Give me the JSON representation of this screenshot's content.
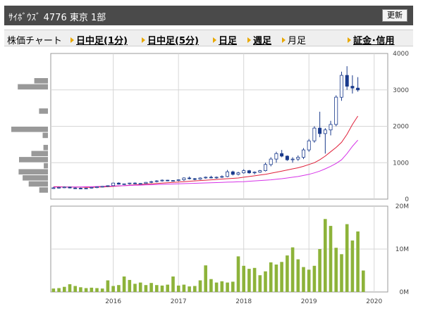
{
  "header": {
    "title": "ｻｲﾎﾞｳｽﾞ 4776 東京 1部",
    "refresh_label": "更新"
  },
  "nav": {
    "label": "株価チャート",
    "items": [
      {
        "label": "日中足(1分)",
        "link": true
      },
      {
        "label": "日中足(5分)",
        "link": true
      },
      {
        "label": "日足",
        "link": true
      },
      {
        "label": "週足",
        "link": true
      },
      {
        "label": "月足",
        "link": false
      },
      {
        "label": "証金･信用",
        "link": true
      }
    ]
  },
  "colors": {
    "up": "#ffffff",
    "down": "#1a3a8c",
    "ma_short": "#e0203a",
    "ma_long": "#d633e8",
    "volume": "#8db33a",
    "profile": "#999999"
  },
  "chart_data": [
    {
      "type": "candlestick",
      "title": "",
      "ylim": [
        0,
        4000
      ],
      "y_ticks": [
        "0",
        "1000",
        "2000",
        "3000",
        "4000"
      ],
      "x_ticks": [
        "2016",
        "2017",
        "2018",
        "2019",
        "2020"
      ],
      "x_start": "2015-08",
      "x_end": "2020-09",
      "series": [
        {
          "name": "",
          "kind": "ohlc",
          "values": [
            [
              300,
              330,
              280,
              310
            ],
            [
              310,
              335,
              290,
              320
            ],
            [
              320,
              345,
              300,
              330
            ],
            [
              330,
              340,
              295,
              305
            ],
            [
              305,
              320,
              280,
              300
            ],
            [
              300,
              315,
              275,
              290
            ],
            [
              290,
              310,
              270,
              300
            ],
            [
              300,
              330,
              290,
              320
            ],
            [
              320,
              340,
              300,
              335
            ],
            [
              335,
              360,
              320,
              350
            ],
            [
              350,
              380,
              330,
              370
            ],
            [
              370,
              450,
              360,
              440
            ],
            [
              440,
              460,
              400,
              410
            ],
            [
              410,
              430,
              390,
              420
            ],
            [
              420,
              450,
              400,
              440
            ],
            [
              440,
              460,
              410,
              420
            ],
            [
              420,
              440,
              400,
              430
            ],
            [
              430,
              470,
              420,
              460
            ],
            [
              460,
              500,
              440,
              480
            ],
            [
              480,
              520,
              460,
              500
            ],
            [
              500,
              540,
              480,
              520
            ],
            [
              520,
              530,
              490,
              500
            ],
            [
              500,
              520,
              480,
              510
            ],
            [
              510,
              540,
              490,
              530
            ],
            [
              530,
              600,
              500,
              580
            ],
            [
              580,
              620,
              540,
              560
            ],
            [
              560,
              580,
              520,
              550
            ],
            [
              550,
              600,
              530,
              580
            ],
            [
              580,
              620,
              560,
              600
            ],
            [
              600,
              640,
              570,
              590
            ],
            [
              590,
              620,
              560,
              600
            ],
            [
              600,
              650,
              580,
              620
            ],
            [
              620,
              800,
              600,
              750
            ],
            [
              750,
              780,
              650,
              680
            ],
            [
              680,
              750,
              650,
              720
            ],
            [
              720,
              820,
              700,
              780
            ],
            [
              780,
              800,
              700,
              720
            ],
            [
              720,
              760,
              680,
              740
            ],
            [
              740,
              800,
              720,
              780
            ],
            [
              780,
              1000,
              760,
              950
            ],
            [
              950,
              1150,
              900,
              1100
            ],
            [
              1100,
              1300,
              1000,
              1250
            ],
            [
              1250,
              1350,
              1150,
              1180
            ],
            [
              1180,
              1200,
              1050,
              1080
            ],
            [
              1080,
              1150,
              1000,
              1100
            ],
            [
              1100,
              1200,
              1050,
              1150
            ],
            [
              1150,
              1400,
              1100,
              1350
            ],
            [
              1350,
              1650,
              1300,
              1600
            ],
            [
              1600,
              2000,
              1550,
              1950
            ],
            [
              1950,
              2400,
              1700,
              1800
            ],
            [
              1800,
              1950,
              1250,
              1900
            ],
            [
              1900,
              2150,
              1750,
              2050
            ],
            [
              2050,
              2850,
              2000,
              2800
            ],
            [
              2800,
              3500,
              2700,
              3400
            ],
            [
              3400,
              3650,
              3000,
              3100
            ],
            [
              3100,
              3400,
              2900,
              3050
            ],
            [
              3050,
              3350,
              2950,
              3000
            ]
          ]
        },
        {
          "name": "",
          "kind": "moving_average",
          "color": "#e0203a",
          "values": [
            340,
            340,
            335,
            335,
            330,
            330,
            325,
            325,
            330,
            335,
            340,
            350,
            360,
            370,
            380,
            390,
            400,
            410,
            420,
            430,
            440,
            450,
            460,
            470,
            480,
            490,
            500,
            510,
            520,
            530,
            540,
            550,
            560,
            570,
            580,
            600,
            620,
            640,
            660,
            680,
            710,
            740,
            770,
            800,
            830,
            860,
            900,
            950,
            1000,
            1080,
            1180,
            1300,
            1420,
            1560,
            1780,
            2050,
            2280
          ]
        },
        {
          "name": "",
          "kind": "moving_average",
          "color": "#d633e8",
          "values": [
            330,
            330,
            330,
            330,
            335,
            335,
            340,
            340,
            345,
            350,
            355,
            360,
            365,
            370,
            375,
            380,
            385,
            390,
            395,
            400,
            405,
            410,
            415,
            420,
            425,
            430,
            435,
            440,
            445,
            450,
            455,
            460,
            465,
            470,
            475,
            480,
            490,
            500,
            510,
            520,
            530,
            545,
            560,
            580,
            600,
            620,
            650,
            680,
            720,
            770,
            830,
            900,
            980,
            1080,
            1250,
            1450,
            1620
          ]
        }
      ]
    },
    {
      "type": "bar",
      "title": "",
      "ylim": [
        0,
        20000000
      ],
      "y_ticks": [
        "0M",
        "10M",
        "20M"
      ],
      "x_ticks": [
        "2016",
        "2017",
        "2018",
        "2019",
        "2020"
      ],
      "series": [
        {
          "name": "",
          "values": [
            800000,
            900000,
            1200000,
            1800000,
            1400000,
            1100000,
            900000,
            1000000,
            900000,
            800000,
            2700000,
            1400000,
            1600000,
            3600000,
            2800000,
            1900000,
            2200000,
            1600000,
            2100000,
            1600000,
            1500000,
            1700000,
            3600000,
            1500000,
            1700000,
            1300000,
            1400000,
            2700000,
            6200000,
            3000000,
            2200000,
            2500000,
            2200000,
            2400000,
            8300000,
            6100000,
            5400000,
            5600000,
            3900000,
            4800000,
            6900000,
            6400000,
            7000000,
            8500000,
            10400000,
            7600000,
            5800000,
            5200000,
            6100000,
            10000000,
            17000000,
            15400000,
            10300000,
            8800000,
            15800000,
            12000000,
            14100000,
            5000000
          ]
        }
      ]
    }
  ]
}
